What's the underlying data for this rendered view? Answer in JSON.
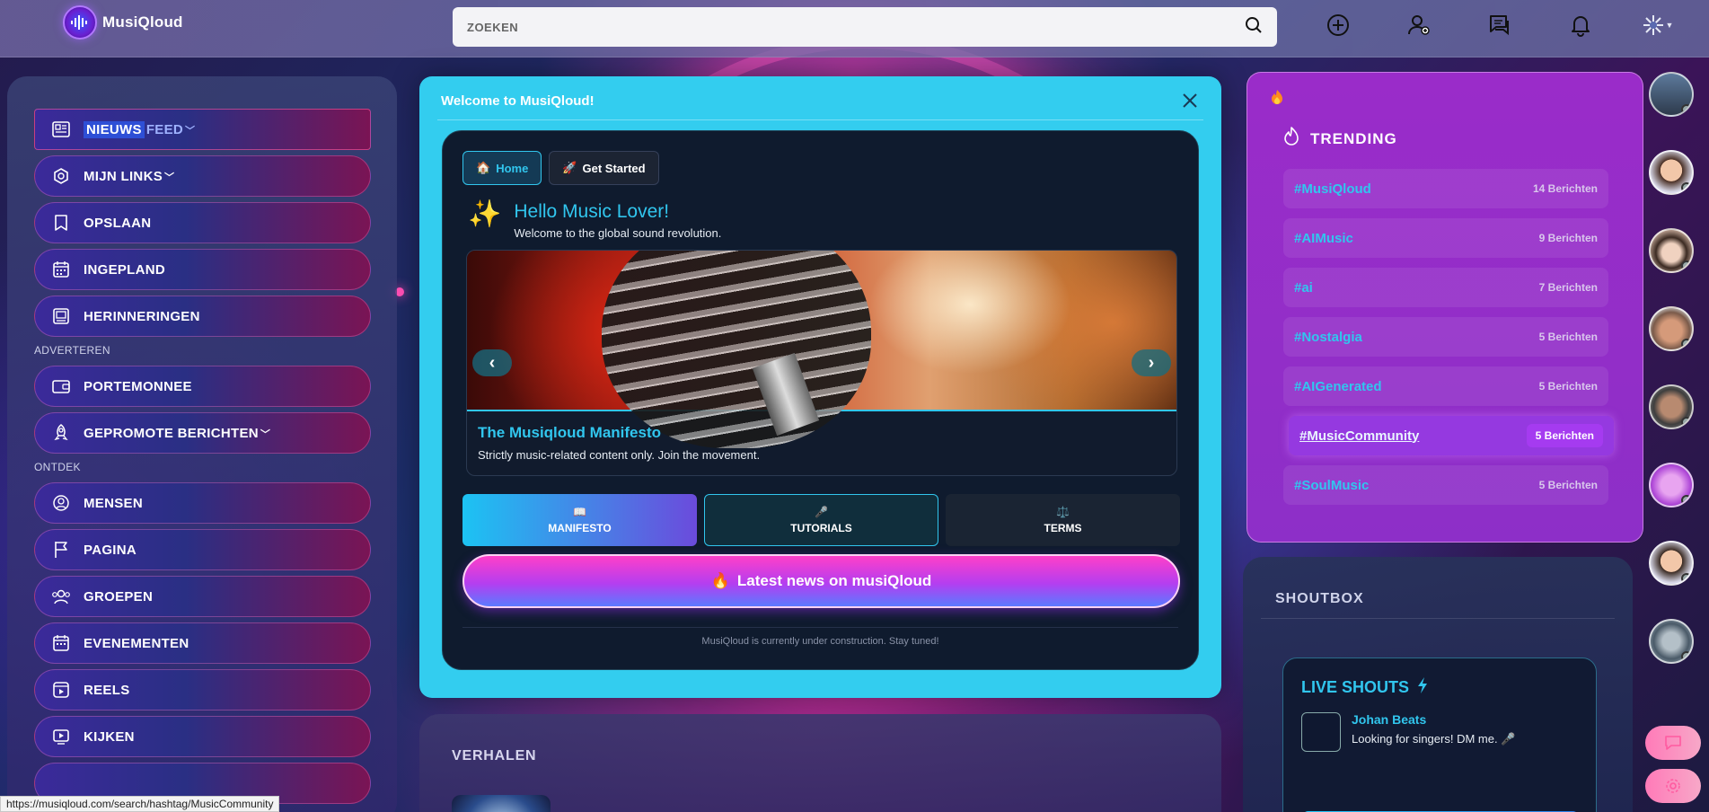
{
  "app": {
    "name": "MusiQloud"
  },
  "search": {
    "placeholder": "ZOEKEN"
  },
  "sidebar": {
    "items": [
      {
        "label_a": "NIEUWS",
        "label_b": "FEED",
        "icon": "newspaper-icon"
      },
      {
        "label": "MIJN LINKS",
        "icon": "link-icon",
        "chevron": true
      },
      {
        "label": "OPSLAAN",
        "icon": "bookmark-icon"
      },
      {
        "label": "INGEPLAND",
        "icon": "calendar-icon"
      },
      {
        "label": "HERINNERINGEN",
        "icon": "memories-icon"
      }
    ],
    "section_advertise": "ADVERTEREN",
    "advertise_items": [
      {
        "label": "PORTEMONNEE",
        "icon": "wallet-icon"
      },
      {
        "label": "GEPROMOTE BERICHTEN",
        "icon": "rocket-icon",
        "chevron": true
      }
    ],
    "section_discover": "ONTDEK",
    "discover_items": [
      {
        "label": "MENSEN",
        "icon": "people-icon"
      },
      {
        "label": "PAGINA",
        "icon": "flag-icon"
      },
      {
        "label": "GROEPEN",
        "icon": "groups-icon"
      },
      {
        "label": "EVENEMENTEN",
        "icon": "events-icon"
      },
      {
        "label": "REELS",
        "icon": "reels-icon"
      },
      {
        "label": "KIJKEN",
        "icon": "watch-icon"
      }
    ]
  },
  "modal": {
    "title": "Welcome to MusiQloud!",
    "tabs": [
      {
        "label": "Home",
        "emoji": "🏠"
      },
      {
        "label": "Get Started",
        "emoji": "🚀"
      }
    ],
    "hello_emoji": "✨",
    "hello_title": "Hello Music Lover!",
    "hello_sub": "Welcome to the global sound revolution.",
    "slide": {
      "title": "The Musiqloud Manifesto",
      "subtitle": "Strictly music-related content only. Join the movement.",
      "prev": "‹",
      "next": "›"
    },
    "buttons": [
      {
        "label": "MANIFESTO",
        "emoji": "📖"
      },
      {
        "label": "TUTORIALS",
        "emoji": "🎤"
      },
      {
        "label": "TERMS",
        "emoji": "⚖️"
      }
    ],
    "news_button": {
      "emoji": "🔥",
      "label": "Latest news on musiQloud"
    },
    "construction": "MusiQloud is currently under construction. Stay tuned!"
  },
  "stories": {
    "title": "VERHALEN"
  },
  "trending": {
    "title": "TRENDING",
    "items": [
      {
        "tag": "#MusiQloud",
        "count": "14 Berichten"
      },
      {
        "tag": "#AIMusic",
        "count": "9 Berichten"
      },
      {
        "tag": "#ai",
        "count": "7 Berichten"
      },
      {
        "tag": "#Nostalgia",
        "count": "5 Berichten"
      },
      {
        "tag": "#AIGenerated",
        "count": "5 Berichten"
      },
      {
        "tag": "#MusicCommunity",
        "count": "5 Berichten"
      },
      {
        "tag": "#SoulMusic",
        "count": "5 Berichten"
      }
    ]
  },
  "shoutbox": {
    "title": "SHOUTBOX",
    "card_title": "LIVE SHOUTS",
    "shout": {
      "name": "Johan Beats",
      "message": "Looking for singers! DM me. 🎤"
    }
  },
  "status_url": "https://musiqloud.com/search/hashtag/MusicCommunity",
  "colors": {
    "accent": "#31c6ee",
    "modal_bg": "#33cdef",
    "trending_bg": "#9a2cc9"
  }
}
